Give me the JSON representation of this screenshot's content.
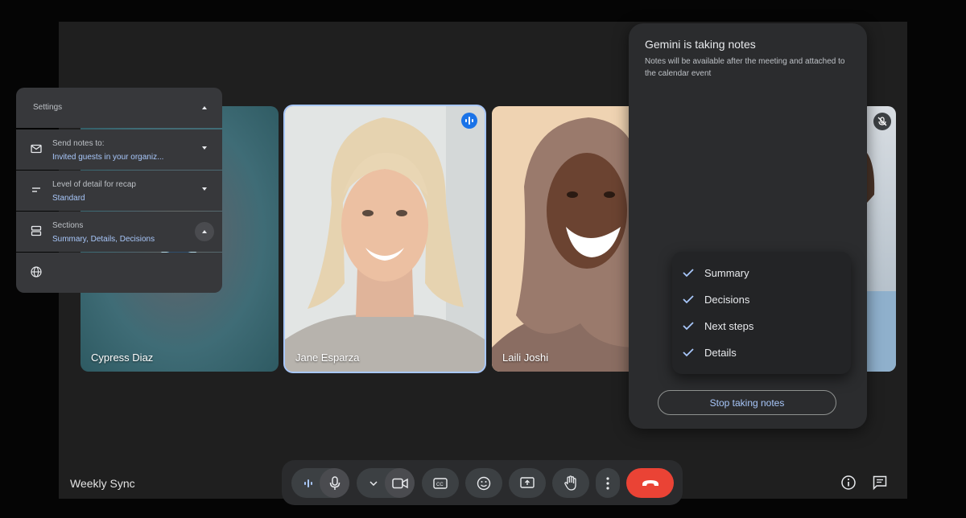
{
  "participants": [
    {
      "name": "Cypress Diaz"
    },
    {
      "name": "Jane Esparza"
    },
    {
      "name": "Laili Joshi"
    }
  ],
  "gemini_panel": {
    "title": "Gemini is taking notes",
    "subtitle": "Notes will be available after the meeting and attached to the calendar event",
    "settings_label": "Settings",
    "rows": [
      {
        "label": "Send notes to:",
        "value": "Invited guests in your organiz..."
      },
      {
        "label": "Level of detail for recap",
        "value": "Standard"
      },
      {
        "label": "Sections",
        "value": "Summary, Details, Decisions"
      }
    ],
    "sections_options": [
      {
        "label": "Summary",
        "checked": true
      },
      {
        "label": "Decisions",
        "checked": true
      },
      {
        "label": "Next steps",
        "checked": true
      },
      {
        "label": "Details",
        "checked": true
      }
    ],
    "stop_button": "Stop taking notes"
  },
  "meeting": {
    "title": "Weekly Sync"
  },
  "controls": {
    "icons": [
      "audio-level-icon",
      "microphone-icon",
      "chevron-down-icon",
      "camera-icon",
      "captions-icon",
      "emoji-icon",
      "present-icon",
      "raise-hand-icon",
      "more-vert-icon",
      "end-call-icon",
      "info-icon",
      "chat-icon"
    ],
    "end_call_color": "#ea4335",
    "accent": "#a8c7fa"
  }
}
